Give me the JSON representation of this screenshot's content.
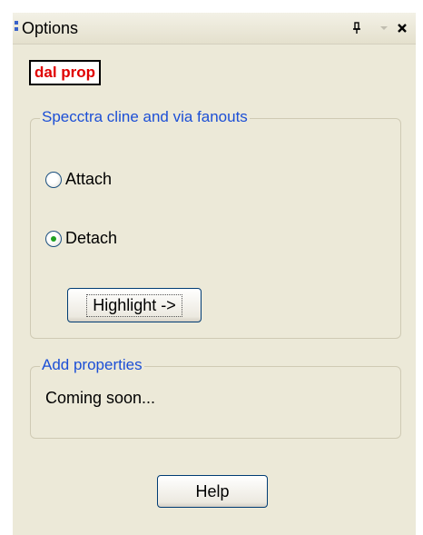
{
  "window": {
    "title": "Options",
    "pin_icon": "pin-icon",
    "dropdown_icon": "dropdown-icon",
    "close_icon": "close-icon"
  },
  "tag_label": "dal prop",
  "fanouts_group": {
    "legend": "Specctra cline and via fanouts",
    "options": [
      {
        "label": "Attach",
        "selected": false
      },
      {
        "label": "Detach",
        "selected": true
      }
    ],
    "highlight_button": "Highlight ->"
  },
  "properties_group": {
    "legend": "Add properties",
    "text": "Coming soon..."
  },
  "help_button": "Help",
  "colors": {
    "accent": "#1c4fd6",
    "tag_text": "#e00000",
    "panel_bg": "#ece9d8"
  }
}
